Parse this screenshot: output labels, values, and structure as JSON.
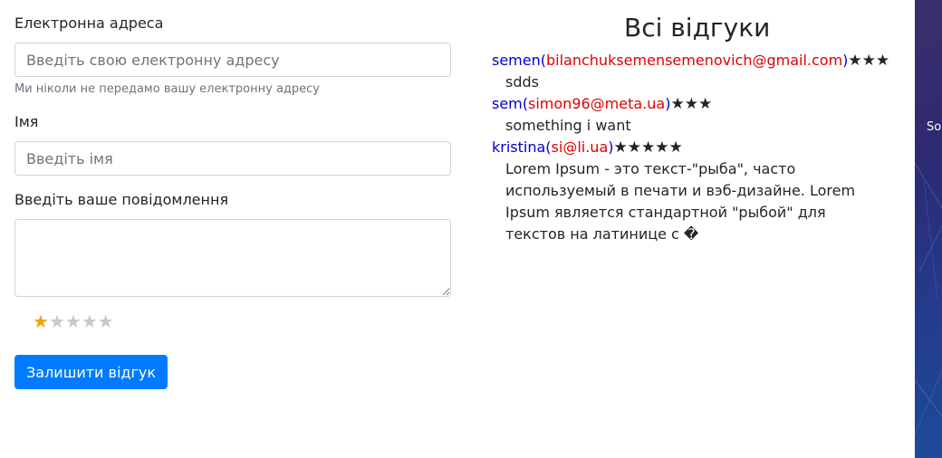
{
  "form": {
    "email_label": "Електронна адреса",
    "email_placeholder": "Введіть свою електронну адресу",
    "email_help": "Ми ніколи не передамо вашу електронну адресу",
    "name_label": "Імя",
    "name_placeholder": "Введіть імя",
    "message_label": "Введіть ваше повідомлення",
    "message_value": "",
    "rating": {
      "value": 1,
      "max": 5
    },
    "submit_label": "Залишити відгук"
  },
  "reviews": {
    "title": "Всі відгуки",
    "items": [
      {
        "name": "semen",
        "email": "bilanchuksemensemenovich@gmail.com",
        "stars": 3,
        "text": "sdds"
      },
      {
        "name": "sem",
        "email": "simon96@meta.ua",
        "stars": 3,
        "text": "something i want"
      },
      {
        "name": "kristina",
        "email": "si@li.ua",
        "stars": 5,
        "text": "Lorem Ipsum - это текст-\"рыба\", часто используемый в печати и вэб-дизайне. Lorem Ipsum является стандартной \"рыбой\" для текстов на латинице с �"
      }
    ]
  },
  "sidebar": {
    "text": "So"
  },
  "colors": {
    "primary": "#007bff",
    "star_active": "#f0a30a",
    "name": "#0000cc",
    "email": "#e00000"
  }
}
